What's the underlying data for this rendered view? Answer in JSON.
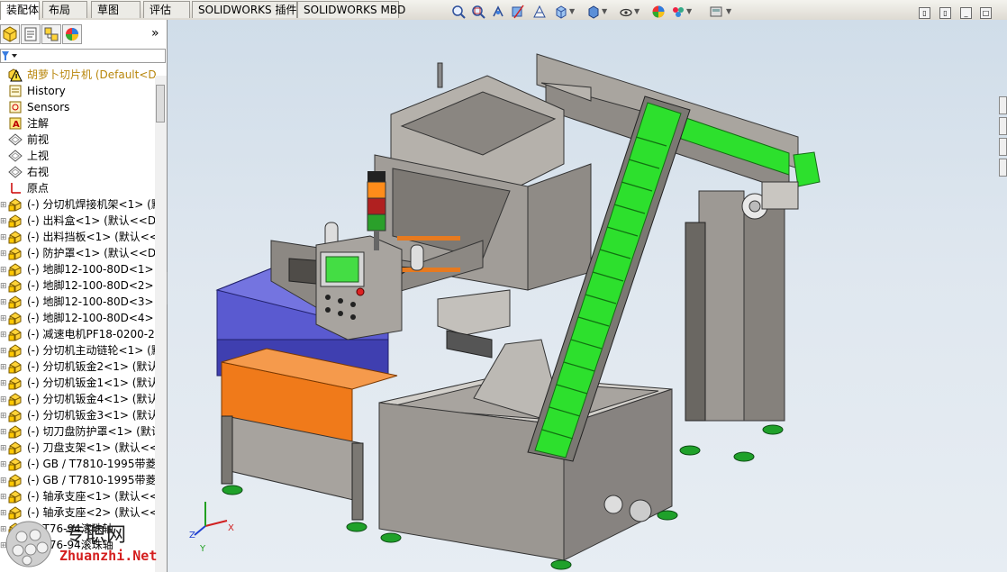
{
  "tabs": [
    "装配体",
    "布局",
    "草图",
    "评估",
    "SOLIDWORKS 插件",
    "SOLIDWORKS MBD"
  ],
  "active_tab": "装配体",
  "hud_icons": [
    "zoom-to-fit-icon",
    "zoom-area-icon",
    "previous-view-icon",
    "section-view-icon",
    "dynamic-annotation-icon",
    "view-orientation-icon",
    "display-style-icon",
    "hide-show-icon",
    "edit-appearance-icon",
    "apply-scene-icon",
    "view-settings-icon"
  ],
  "panel_tabs": [
    "feature-manager-icon",
    "property-manager-icon",
    "configuration-manager-icon",
    "display-manager-icon"
  ],
  "panel_more": "»",
  "tree": [
    {
      "label": "胡萝卜切片机  (Default<D",
      "icon": "assembly-warning-icon",
      "warn": true
    },
    {
      "label": "History",
      "icon": "history-icon"
    },
    {
      "label": "Sensors",
      "icon": "sensors-icon"
    },
    {
      "label": "注解",
      "icon": "annotations-icon"
    },
    {
      "label": "前视",
      "icon": "plane-icon"
    },
    {
      "label": "上视",
      "icon": "plane-icon"
    },
    {
      "label": "右视",
      "icon": "plane-icon"
    },
    {
      "label": "原点",
      "icon": "origin-icon"
    },
    {
      "label": "(-) 分切机焊接机架<1> (默",
      "icon": "part-icon"
    },
    {
      "label": "(-) 出料盒<1> (默认<<De",
      "icon": "part-icon"
    },
    {
      "label": "(-) 出料挡板<1> (默认<<",
      "icon": "part-icon"
    },
    {
      "label": "(-) 防护罩<1> (默认<<De",
      "icon": "part-icon"
    },
    {
      "label": "(-) 地脚12-100-80D<1>",
      "icon": "part-icon"
    },
    {
      "label": "(-) 地脚12-100-80D<2>",
      "icon": "part-icon"
    },
    {
      "label": "(-) 地脚12-100-80D<3>",
      "icon": "part-icon"
    },
    {
      "label": "(-) 地脚12-100-80D<4>",
      "icon": "part-icon"
    },
    {
      "label": "(-) 减速电机PF18-0200-25",
      "icon": "part-icon"
    },
    {
      "label": "(-) 分切机主动链轮<1> (默",
      "icon": "part-icon"
    },
    {
      "label": "(-) 分切机钣金2<1> (默认",
      "icon": "part-icon"
    },
    {
      "label": "(-) 分切机钣金1<1> (默认",
      "icon": "part-icon"
    },
    {
      "label": "(-) 分切机钣金4<1> (默认",
      "icon": "part-icon"
    },
    {
      "label": "(-) 分切机钣金3<1> (默认",
      "icon": "part-icon"
    },
    {
      "label": "(-) 切刀盘防护罩<1> (默认",
      "icon": "part-icon"
    },
    {
      "label": "(-) 刀盘支架<1> (默认<<",
      "icon": "part-icon"
    },
    {
      "label": "(-) GB / T7810-1995带菱",
      "icon": "part-icon"
    },
    {
      "label": "(-) GB / T7810-1995带菱",
      "icon": "part-icon"
    },
    {
      "label": "(-) 轴承支座<1> (默认<<",
      "icon": "part-icon"
    },
    {
      "label": "(-) 轴承支座<2> (默认<<",
      "icon": "part-icon"
    },
    {
      "label": "(-) T76-94滚珠轴",
      "icon": "part-icon"
    },
    {
      "label": "(-) T76-94滚珠轴",
      "icon": "part-icon"
    }
  ],
  "axes": {
    "x": "X",
    "y": "Y",
    "z": "Z"
  },
  "watermark": {
    "cn": "专职网",
    "en": "Zhuanzhi.Net"
  },
  "colors": {
    "belt_green": "#22e622",
    "frame_grey": "#9a9590",
    "cabinet_blue": "#5a5ad0",
    "guard_orange": "#f07a1a",
    "foot_green": "#1fa12a"
  }
}
